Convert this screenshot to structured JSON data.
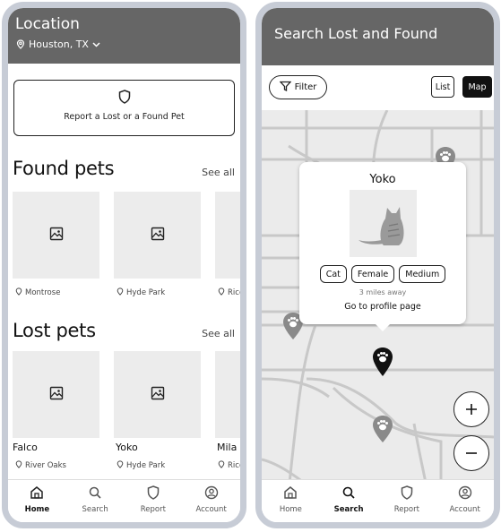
{
  "home": {
    "header": {
      "title": "Location",
      "city": "Houston, TX"
    },
    "report_card": {
      "label": "Report a Lost or a Found Pet"
    },
    "found": {
      "title": "Found pets",
      "see_all": "See all",
      "items": [
        {
          "location": "Montrose"
        },
        {
          "location": "Hyde Park"
        },
        {
          "location": "Rice"
        }
      ]
    },
    "lost": {
      "title": "Lost pets",
      "see_all": "See all",
      "items": [
        {
          "name": "Falco",
          "location": "River Oaks"
        },
        {
          "name": "Yoko",
          "location": "Hyde Park"
        },
        {
          "name": "Mila",
          "location": "Rice"
        }
      ]
    },
    "tabs": [
      {
        "label": "Home",
        "icon": "home-icon",
        "active": true
      },
      {
        "label": "Search",
        "icon": "search-icon",
        "active": false
      },
      {
        "label": "Report",
        "icon": "shield-icon",
        "active": false
      },
      {
        "label": "Account",
        "icon": "account-icon",
        "active": false
      }
    ]
  },
  "search": {
    "header": {
      "title": "Search Lost and Found"
    },
    "filter_label": "Filter",
    "view_list": "List",
    "view_map": "Map",
    "view_selected": "Map",
    "popup": {
      "name": "Yoko",
      "tags": [
        "Cat",
        "Female",
        "Medium"
      ],
      "distance": "3 miles away",
      "link": "Go to profile page"
    },
    "zoom_in": "+",
    "zoom_out": "−",
    "tabs": [
      {
        "label": "Home",
        "icon": "home-icon",
        "active": false
      },
      {
        "label": "Search",
        "icon": "search-icon",
        "active": true
      },
      {
        "label": "Report",
        "icon": "shield-icon",
        "active": false
      },
      {
        "label": "Account",
        "icon": "account-icon",
        "active": false
      }
    ]
  },
  "colors": {
    "header": "#666666",
    "tile": "#ececec",
    "map": "#ebebeb",
    "pin_active": "#111111",
    "pin": "#8a8a8a"
  }
}
